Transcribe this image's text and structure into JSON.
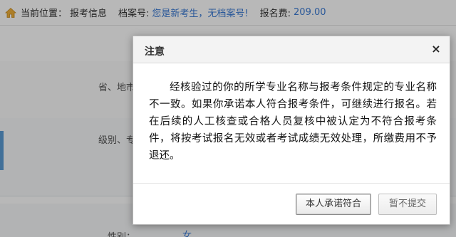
{
  "breadcrumb": {
    "location_label": "当前位置：",
    "location_value": "报考信息",
    "file_no_label": "档案号:",
    "file_no_value": "您是新考生，无档案号!",
    "fee_label": "报名费:",
    "fee_value": "209.00"
  },
  "form": {
    "region_label": "省、地市",
    "level_label": "级别、专",
    "gender_label": "性别：",
    "gender_value": "女"
  },
  "dialog": {
    "title": "注意",
    "close_icon": "×",
    "message": "经核验过的你的所学专业名称与报考条件规定的专业名称不一致。如果你承诺本人符合报考条件，可继续进行报名。若在后续的人工核查或合格人员复核中被认定为不符合报考条件，将按考试报名无效或者考试成绩无效处理，所缴费用不予退还。",
    "confirm_button": "本人承诺符合",
    "later_button": "暂不提交"
  },
  "colors": {
    "accent_blue": "#3b7bd4",
    "overlay": "rgba(0,0,0,0.28)"
  },
  "icons": {
    "home": "home-icon",
    "close": "close-icon"
  }
}
